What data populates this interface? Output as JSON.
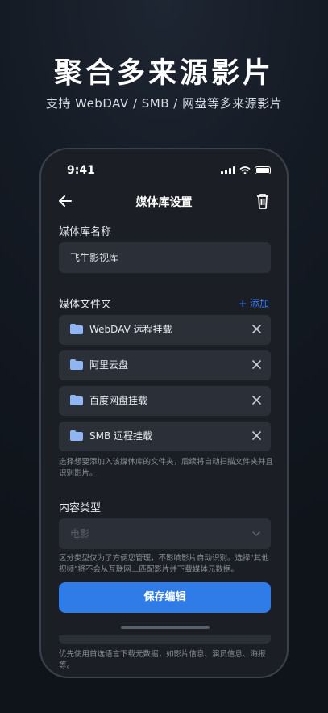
{
  "hero": {
    "title": "聚合多来源影片",
    "subtitle": "支持 WebDAV / SMB / 网盘等多来源影片"
  },
  "status_bar": {
    "time": "9:41"
  },
  "nav": {
    "title": "媒体库设置",
    "back_icon": "arrow-left-icon",
    "delete_icon": "trash-icon"
  },
  "library_name": {
    "label": "媒体库名称",
    "value": "飞牛影视库"
  },
  "folders": {
    "label": "媒体文件夹",
    "add_label": "+ 添加",
    "items": [
      {
        "name": "WebDAV 远程挂载"
      },
      {
        "name": "阿里云盘"
      },
      {
        "name": "百度网盘挂载"
      },
      {
        "name": "SMB 远程挂载"
      }
    ],
    "hint": "选择想要添加入该媒体库的文件夹，后续将自动扫描文件夹并且识别影片。"
  },
  "content_type": {
    "label": "内容类型",
    "placeholder": "电影",
    "hint": "区分类型仅为了方便您管理，不影响影片自动识别。选择\"其他视频\"将不会从互联网上匹配影片并下载媒体元数据。"
  },
  "save_button": {
    "label": "保存编辑"
  },
  "footer_hint": "优先使用首选语言下载元数据，如影片信息、演员信息、海报等。",
  "colors": {
    "accent": "#2f7be8",
    "link": "#3b7df0",
    "folder": "#8fb6f3"
  }
}
